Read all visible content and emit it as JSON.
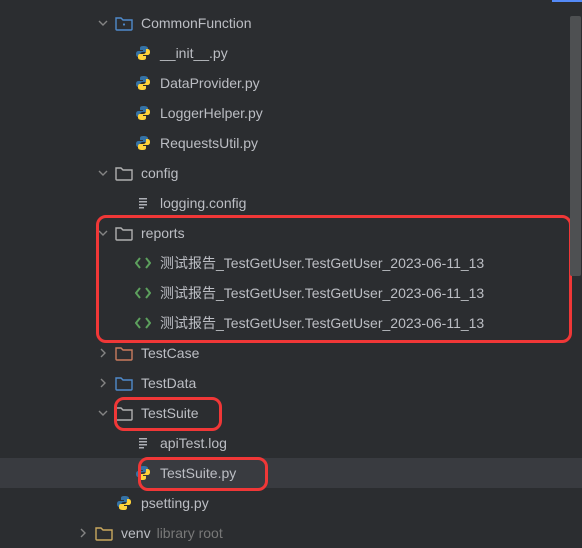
{
  "tree": {
    "commonFunction": {
      "label": "CommonFunction"
    },
    "initpy": {
      "label": "__init__.py"
    },
    "dataProvider": {
      "label": "DataProvider.py"
    },
    "loggerHelper": {
      "label": "LoggerHelper.py"
    },
    "requestsUtil": {
      "label": "RequestsUtil.py"
    },
    "config": {
      "label": "config"
    },
    "loggingConfig": {
      "label": "logging.config"
    },
    "reports": {
      "label": "reports"
    },
    "report1": {
      "label": "测试报告_TestGetUser.TestGetUser_2023-06-11_13"
    },
    "report2": {
      "label": "测试报告_TestGetUser.TestGetUser_2023-06-11_13"
    },
    "report3": {
      "label": "测试报告_TestGetUser.TestGetUser_2023-06-11_13"
    },
    "testCase": {
      "label": "TestCase"
    },
    "testData": {
      "label": "TestData"
    },
    "testSuite": {
      "label": "TestSuite"
    },
    "apiTestLog": {
      "label": "apiTest.log"
    },
    "testSuitePy": {
      "label": "TestSuite.py"
    },
    "psetting": {
      "label": "psetting.py"
    },
    "venv": {
      "label": "venv",
      "hint": "library root"
    }
  }
}
